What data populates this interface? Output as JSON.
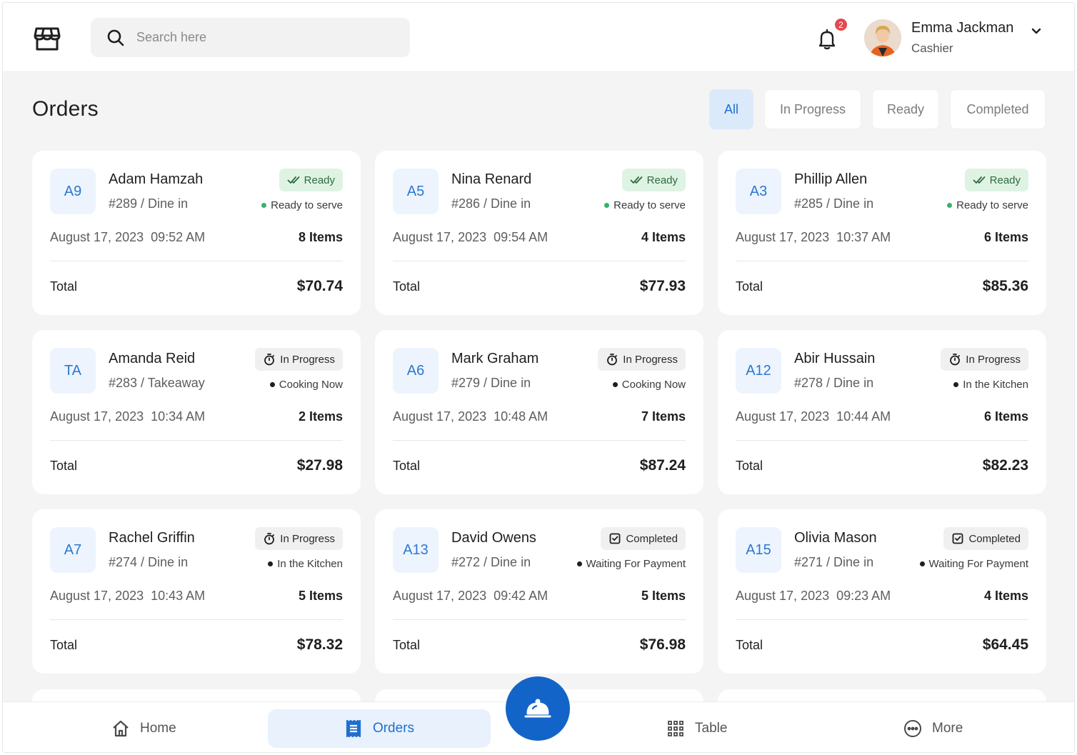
{
  "header": {
    "search_placeholder": "Search here",
    "notification_count": "2",
    "user": {
      "name": "Emma Jackman",
      "role": "Cashier"
    }
  },
  "page": {
    "title": "Orders",
    "filters": [
      "All",
      "In Progress",
      "Ready",
      "Completed"
    ],
    "active_filter": "All"
  },
  "orders": [
    {
      "code": "A9",
      "name": "Adam Hamzah",
      "ref": "#289 / Dine in",
      "status": "Ready",
      "status_type": "ready",
      "sub": "Ready to serve",
      "date": "August 17, 2023  09:52 AM",
      "items": "8 Items",
      "total_label": "Total",
      "total": "$70.74"
    },
    {
      "code": "A5",
      "name": "Nina Renard",
      "ref": "#286 / Dine in",
      "status": "Ready",
      "status_type": "ready",
      "sub": "Ready to serve",
      "date": "August 17, 2023  09:54 AM",
      "items": "4 Items",
      "total_label": "Total",
      "total": "$77.93"
    },
    {
      "code": "A3",
      "name": "Phillip Allen",
      "ref": "#285 / Dine in",
      "status": "Ready",
      "status_type": "ready",
      "sub": "Ready to serve",
      "date": "August 17, 2023  10:37 AM",
      "items": "6 Items",
      "total_label": "Total",
      "total": "$85.36"
    },
    {
      "code": "TA",
      "name": "Amanda Reid",
      "ref": "#283 / Takeaway",
      "status": "In Progress",
      "status_type": "prog",
      "sub": "Cooking Now",
      "date": "August 17, 2023  10:34 AM",
      "items": "2 Items",
      "total_label": "Total",
      "total": "$27.98"
    },
    {
      "code": "A6",
      "name": "Mark Graham",
      "ref": "#279 / Dine in",
      "status": "In Progress",
      "status_type": "prog",
      "sub": "Cooking Now",
      "date": "August 17, 2023  10:48 AM",
      "items": "7 Items",
      "total_label": "Total",
      "total": "$87.24"
    },
    {
      "code": "A12",
      "name": "Abir Hussain",
      "ref": "#278 / Dine in",
      "status": "In Progress",
      "status_type": "prog",
      "sub": "In the Kitchen",
      "date": "August 17, 2023  10:44 AM",
      "items": "6 Items",
      "total_label": "Total",
      "total": "$82.23"
    },
    {
      "code": "A7",
      "name": "Rachel Griffin",
      "ref": "#274 / Dine in",
      "status": "In Progress",
      "status_type": "prog",
      "sub": "In the Kitchen",
      "date": "August 17, 2023  10:43 AM",
      "items": "5 Items",
      "total_label": "Total",
      "total": "$78.32"
    },
    {
      "code": "A13",
      "name": "David Owens",
      "ref": "#272 / Dine in",
      "status": "Completed",
      "status_type": "done",
      "sub": "Waiting For Payment",
      "date": "August 17, 2023  09:42 AM",
      "items": "5 Items",
      "total_label": "Total",
      "total": "$76.98"
    },
    {
      "code": "A15",
      "name": "Olivia Mason",
      "ref": "#271 / Dine in",
      "status": "Completed",
      "status_type": "done",
      "sub": "Waiting For Payment",
      "date": "August 17, 2023  09:23 AM",
      "items": "4 Items",
      "total_label": "Total",
      "total": "$64.45"
    }
  ],
  "bottom_nav": {
    "home": "Home",
    "orders": "Orders",
    "table": "Table",
    "more": "More",
    "active": "Orders"
  },
  "colors": {
    "accent": "#1364c9",
    "accent_light": "#dbeafb",
    "ready_bg": "#dff3e4",
    "ready_dot": "#34b36b",
    "notification": "#e5484d"
  },
  "icons": {
    "logo": "store-icon",
    "search": "search-icon",
    "notifications": "bell-icon",
    "user_menu": "chevron-down-icon",
    "status_ready": "double-check-icon",
    "status_in_progress": "stopwatch-icon",
    "status_completed": "checkbox-icon",
    "nav_home": "home-icon",
    "nav_orders": "receipt-icon",
    "nav_table": "grid-icon",
    "nav_more": "more-icon",
    "fab": "cloche-icon"
  }
}
